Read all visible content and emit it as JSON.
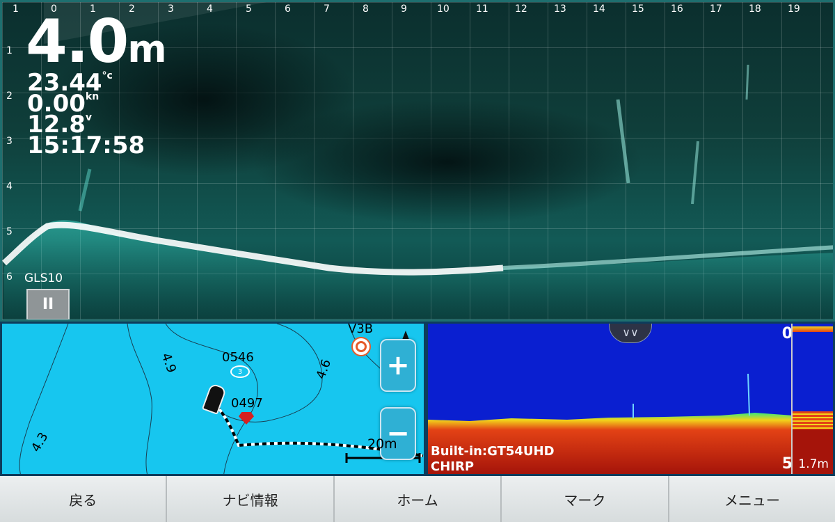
{
  "sidescan": {
    "x_scale": [
      "1",
      "0",
      "1",
      "2",
      "3",
      "4",
      "5",
      "6",
      "7",
      "8",
      "9",
      "10",
      "11",
      "12",
      "13",
      "14",
      "15",
      "16",
      "17",
      "18",
      "19"
    ],
    "y_scale": [
      "1",
      "2",
      "3",
      "4",
      "5",
      "6"
    ],
    "depth_value": "4.0",
    "depth_unit": "m",
    "temperature_value": "23.44",
    "temperature_unit": "°c",
    "speed_value": "0.00",
    "speed_unit": "kn",
    "voltage_value": "12.8",
    "voltage_unit": "v",
    "time": "15:17:58",
    "transducer_label": "GLS10",
    "pause_symbol": "II"
  },
  "map": {
    "contour_labels": [
      "4.9",
      "4.6",
      "4.3"
    ],
    "waypoint_a": "0546",
    "waypoint_b": "0497",
    "waypoint_c": "V3B",
    "fish_count": "3",
    "scale_label": "20m",
    "zoom_in": "+",
    "zoom_out": "−",
    "north_icon": "north-arrow"
  },
  "fishfinder": {
    "depth_top": "0",
    "depth_bottom": "5",
    "source": "Built-in:GT54UHD",
    "mode": "CHIRP",
    "amascope_range": "1.7m",
    "collapse_icon": "chevrons-down"
  },
  "navbar": {
    "back": "戻る",
    "nav_info": "ナビ情報",
    "home": "ホーム",
    "mark": "マーク",
    "menu": "メニュー"
  }
}
